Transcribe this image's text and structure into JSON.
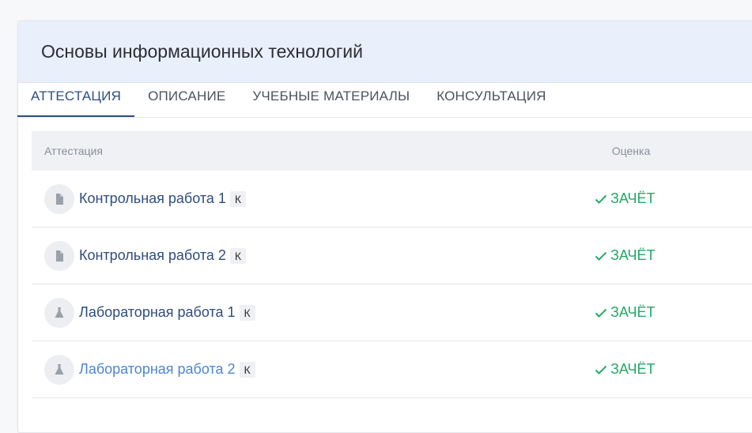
{
  "course": {
    "title": "Основы информационных технологий"
  },
  "tabs": [
    {
      "label": "АТТЕСТАЦИЯ"
    },
    {
      "label": "ОПИСАНИЕ"
    },
    {
      "label": "УЧЕБНЫЕ МАТЕРИАЛЫ"
    },
    {
      "label": "КОНСУЛЬТАЦИЯ"
    }
  ],
  "table": {
    "headers": {
      "name": "Аттестация",
      "grade": "Оценка"
    },
    "rows": [
      {
        "name": "Контрольная работа 1",
        "badge": "К",
        "grade": "ЗАЧЁТ",
        "icon": "document-icon"
      },
      {
        "name": "Контрольная работа 2",
        "badge": "К",
        "grade": "ЗАЧЁТ",
        "icon": "document-icon"
      },
      {
        "name": "Лабораторная работа 1",
        "badge": "К",
        "grade": "ЗАЧЁТ",
        "icon": "flask-icon"
      },
      {
        "name": "Лабораторная работа 2",
        "badge": "К",
        "grade": "ЗАЧЁТ",
        "icon": "flask-icon"
      }
    ]
  },
  "colors": {
    "accent": "#2c4e85",
    "pass": "#23a867",
    "header_bg": "#e9f0fc",
    "link_hover": "#4d86cf"
  }
}
